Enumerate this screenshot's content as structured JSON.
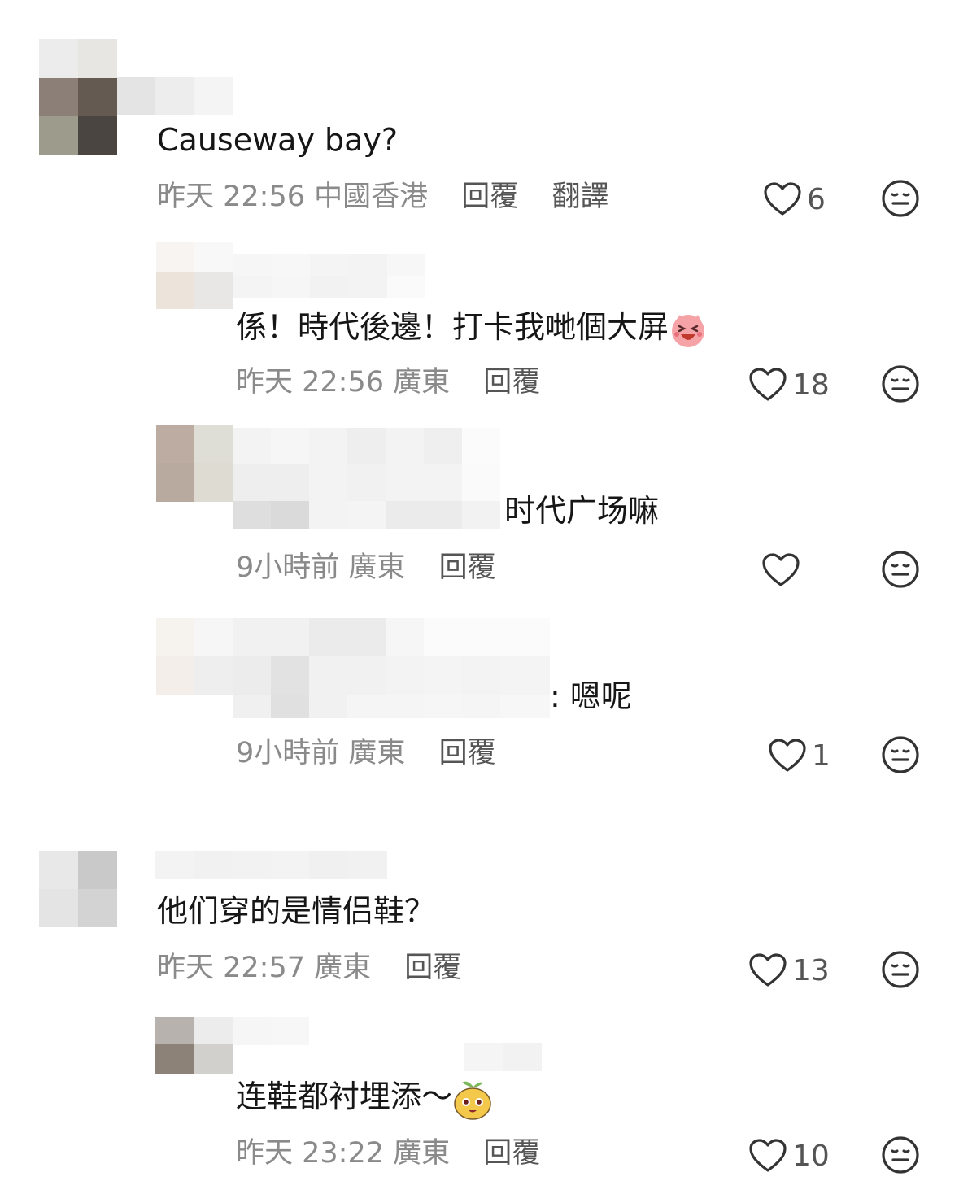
{
  "comments": [
    {
      "text": "Causeway bay?",
      "date": "昨天 22:56",
      "location": "中國香港",
      "reply": "回覆",
      "translate": "翻譯",
      "likes": "6"
    },
    {
      "text": "係！時代後邊！打卡我哋個大屏",
      "date": "昨天 22:56",
      "location": "廣東",
      "reply": "回覆",
      "likes": "18",
      "emoji": "laughing-face-emoji"
    },
    {
      "text": "时代广场嘛",
      "date": "9小時前",
      "location": "廣東",
      "reply": "回覆",
      "likes": ""
    },
    {
      "text": ": 嗯呢",
      "date": "9小時前",
      "location": "廣東",
      "reply": "回覆",
      "likes": "1"
    },
    {
      "text": "他们穿的是情侣鞋？",
      "date": "昨天 22:57",
      "location": "廣東",
      "reply": "回覆",
      "likes": "13"
    },
    {
      "text": "连鞋都衬埋添～",
      "date": "昨天 23:22",
      "location": "廣東",
      "reply": "回覆",
      "likes": "10",
      "emoji": "sprout-character-emoji"
    }
  ],
  "icons": {
    "like": "heart-outline-icon",
    "reaction": "meh-face-icon"
  },
  "colors": {
    "text": "#161616",
    "meta": "#8a8a8a",
    "action": "#555555"
  }
}
